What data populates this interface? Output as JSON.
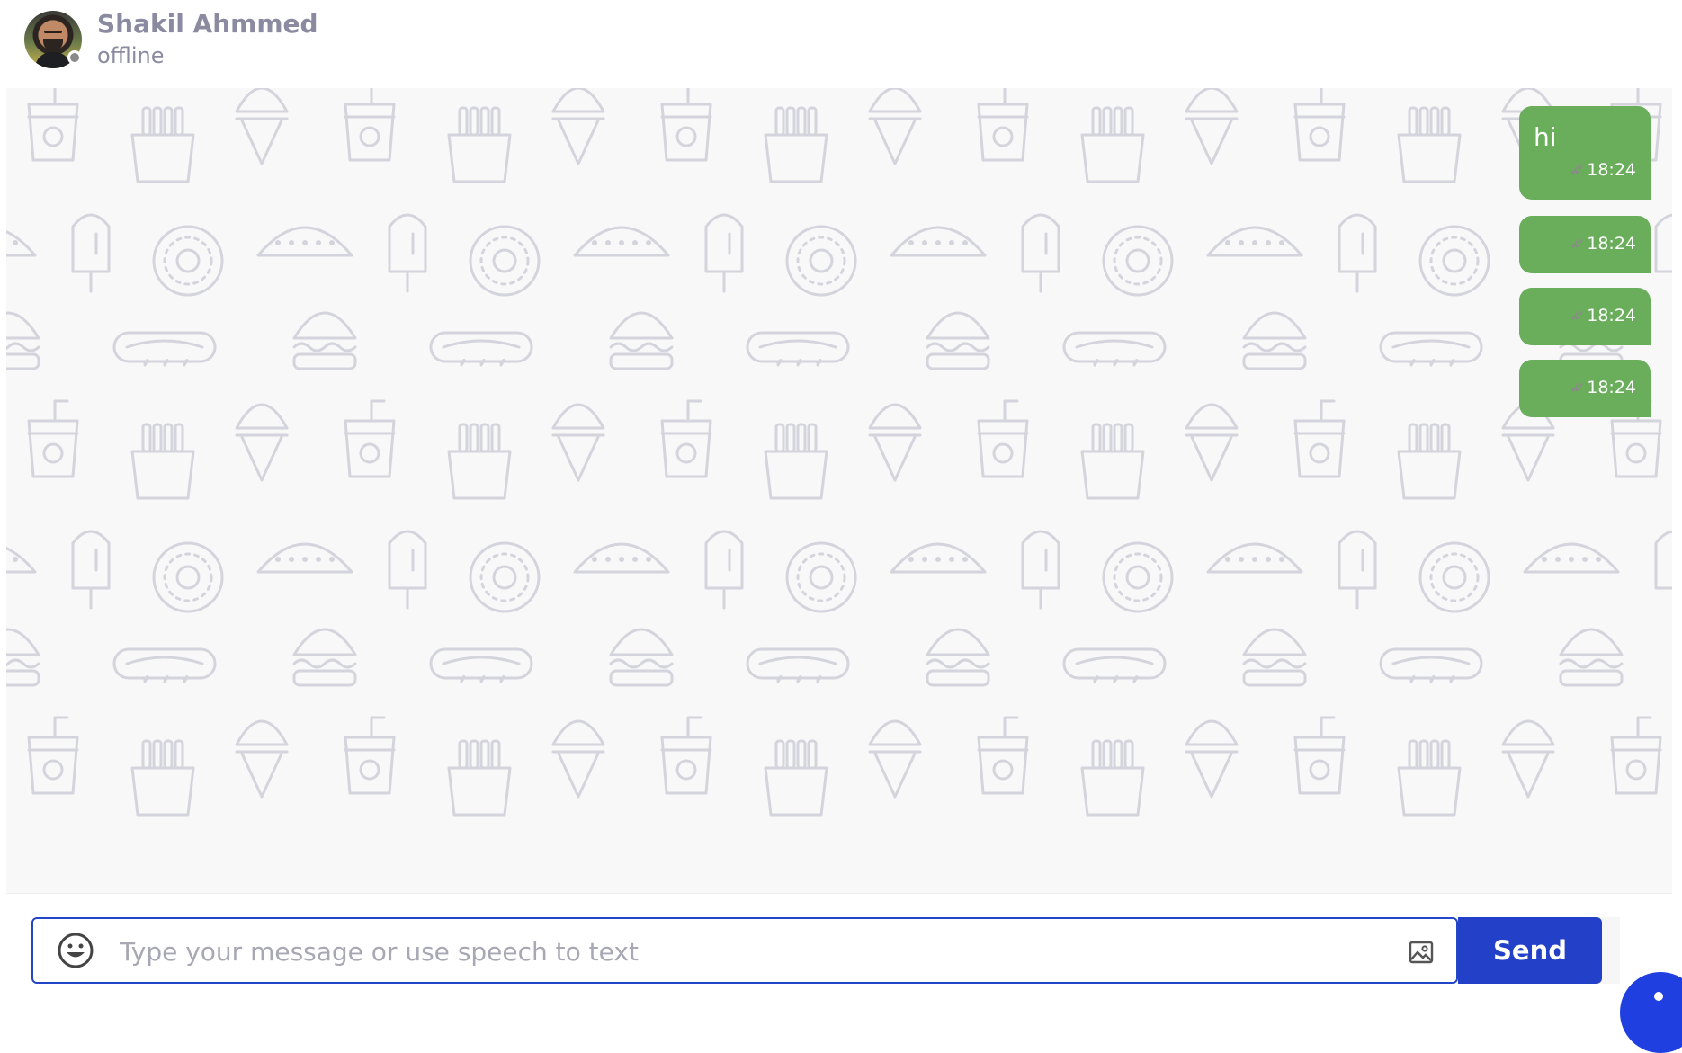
{
  "header": {
    "contact_name": "Shakil Ahmmed",
    "contact_status": "offline",
    "avatar_icon": "profile-photo",
    "status_dot_color": "#8a8a8a"
  },
  "chat": {
    "background_pattern": "food-doodle-icons",
    "messages": [
      {
        "text": "hi",
        "time": "18:24",
        "status": "read"
      },
      {
        "text": "",
        "time": "18:24",
        "status": "read"
      },
      {
        "text": "",
        "time": "18:24",
        "status": "read"
      },
      {
        "text": "",
        "time": "18:24",
        "status": "read"
      }
    ],
    "bubble_color": "#6aae5c"
  },
  "composer": {
    "placeholder": "Type your message or use speech to text",
    "emoji_icon": "smiley-icon",
    "image_icon": "image-icon",
    "send_label": "Send",
    "accent_color": "#2340c9"
  }
}
